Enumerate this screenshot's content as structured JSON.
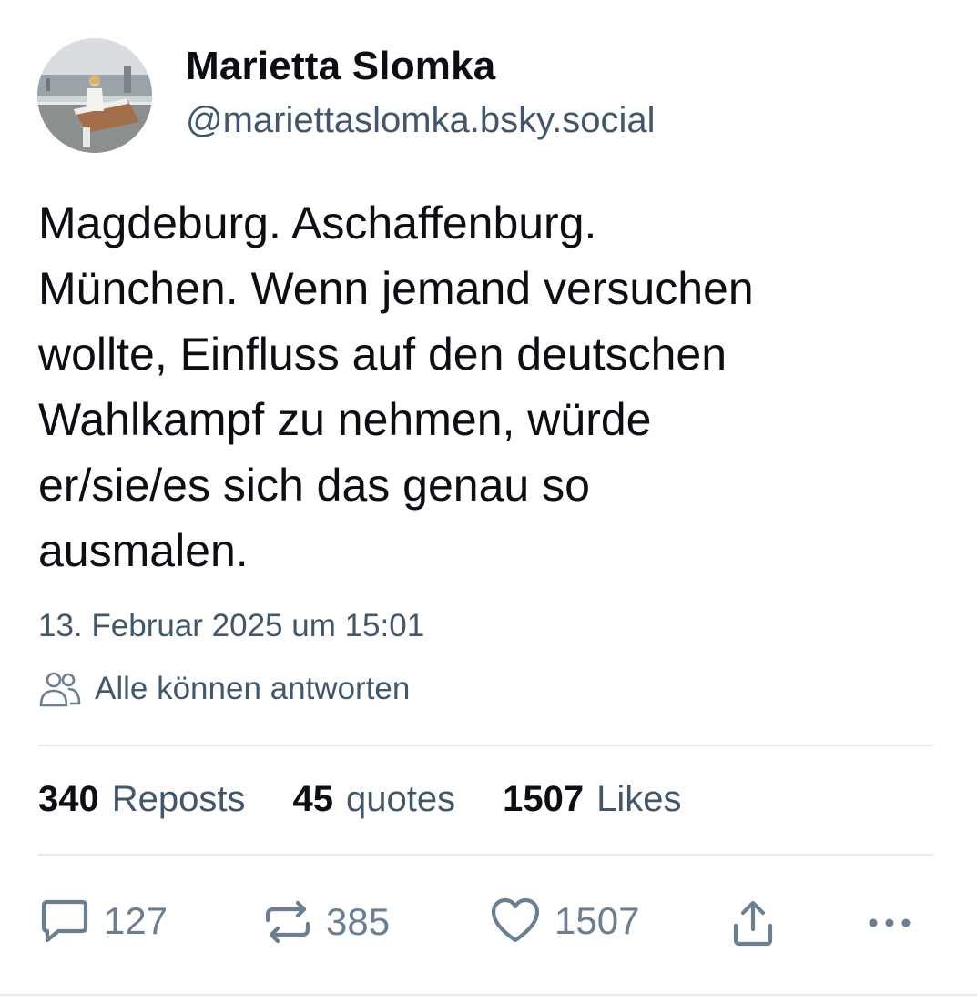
{
  "author": {
    "display_name": "Marietta Slomka",
    "handle": "@mariettaslomka.bsky.social"
  },
  "post": {
    "text": "Magdeburg. Aschaffenburg.\nMünchen. Wenn jemand versuchen\nwollte, Einfluss auf den deutschen\nWahlkampf zu nehmen, würde\ner/sie/es sich das genau so\nausmalen.",
    "timestamp": "13. Februar 2025 um 15:01",
    "reply_setting": "Alle können antworten"
  },
  "stats": {
    "reposts_count": "340",
    "reposts_label": "Reposts",
    "quotes_count": "45",
    "quotes_label": "quotes",
    "likes_count": "1507",
    "likes_label": "Likes"
  },
  "actions": {
    "reply_count": "127",
    "repost_count": "385",
    "like_count": "1507"
  },
  "icons": {
    "reply_setting": "people-icon",
    "reply": "comment-icon",
    "repost": "repost-icon",
    "like": "heart-icon",
    "share": "share-icon",
    "more": "more-icon"
  },
  "colors": {
    "text": "#0b0f14",
    "muted": "#42576c",
    "icon": "#6b7f93",
    "divider": "#e4e8ec"
  }
}
